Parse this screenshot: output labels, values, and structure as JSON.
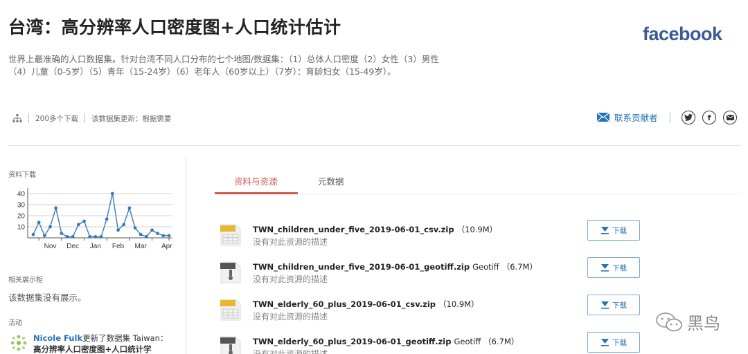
{
  "header": {
    "title": "台湾：高分辨率人口密度图+人口统计估计",
    "brand": "facebook",
    "description_line1": "世界上最准确的人口数据集。针对台湾不同人口分布的七个地图/数据集：（1）总体人口密度（2）女性（3）男性",
    "description_line2": "（4）儿童（0-5岁）（5）青年（15-24岁）（6）老年人（60岁以上）（7岁）：育龄妇女（15-49岁）。"
  },
  "meta": {
    "downloads": "200多个下载",
    "update": "该数据集更新：根据需要"
  },
  "contact": {
    "label": "联系贡献者"
  },
  "social": {
    "twitter": "twitter-icon",
    "facebook": "f",
    "email": "email-icon"
  },
  "sidebar": {
    "downloads_heading": "资料下载",
    "showcase_heading": "相关展示柜",
    "showcase_text": "该数据集没有展示。",
    "activity_heading": "活动",
    "activity": {
      "user": "Nicole Fulk",
      "action": "更新了数据集 Taiwan：",
      "dataset": "高分辨率人口密度图+人口统计学"
    }
  },
  "chart_data": {
    "type": "line",
    "title": "",
    "xlabel": "",
    "ylabel": "",
    "ylim": [
      0,
      45
    ],
    "yticks": [
      10,
      20,
      30,
      40
    ],
    "xtick_labels": [
      "Nov",
      "Dec",
      "Jan",
      "Feb",
      "Mar",
      "Apr"
    ],
    "values": [
      3,
      14,
      2,
      10,
      27,
      4,
      1,
      1,
      12,
      15,
      1,
      1,
      1,
      17,
      40,
      7,
      12,
      27,
      9,
      3,
      1,
      7,
      4,
      2,
      2
    ],
    "color": "#3a7ab8",
    "grid": true
  },
  "tabs": [
    {
      "label": "资料与资源",
      "active": true
    },
    {
      "label": "元数据",
      "active": false
    }
  ],
  "resources": [
    {
      "name": "TWN_children_under_five_2019-06-01_csv.zip",
      "format": "",
      "size": "（10.9M）",
      "description": "没有对此资源的描述",
      "icon": "csv",
      "button": "下载"
    },
    {
      "name": "TWN_children_under_five_2019-06-01_geotiff.zip",
      "format": "Geotiff",
      "size": "（6.7M）",
      "description": "没有对此资源的描述",
      "icon": "zip",
      "button": "下载"
    },
    {
      "name": "TWN_elderly_60_plus_2019-06-01_csv.zip",
      "format": "",
      "size": "（10.9M）",
      "description": "没有对此资源的描述",
      "icon": "csv",
      "button": "下载"
    },
    {
      "name": "TWN_elderly_60_plus_2019-06-01_geotiff.zip",
      "format": "Geotiff",
      "size": "（6.7M）",
      "description": "没有对此资源的描述",
      "icon": "zip",
      "button": "下载"
    }
  ],
  "watermark": "黑鸟",
  "colors": {
    "accent_red": "#d9534f",
    "link_blue": "#2572b8",
    "facebook_blue": "#3b5998",
    "csv_icon": "#e8b730",
    "zip_icon": "#555555"
  }
}
